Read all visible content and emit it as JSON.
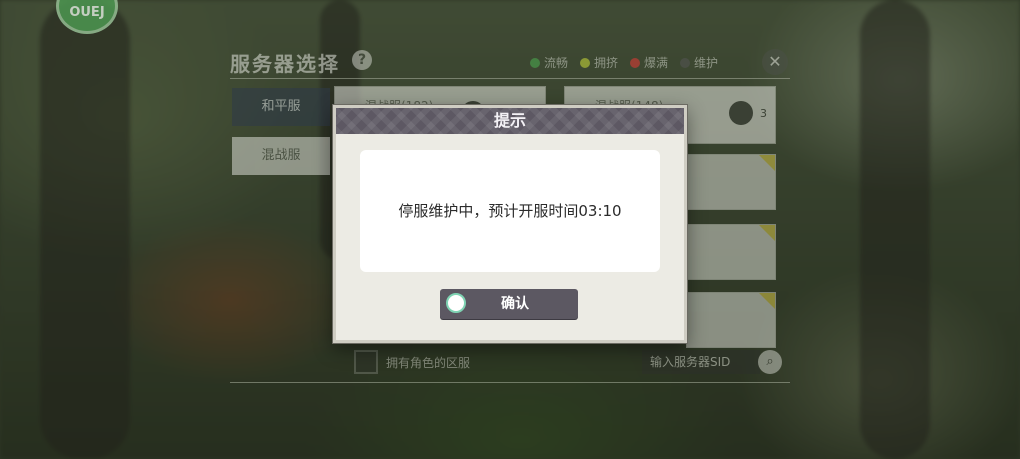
{
  "top_badge": {
    "text": "OUEJ"
  },
  "panel": {
    "title": "服务器选择",
    "help_icon": "?",
    "close_icon": "✕",
    "legend": [
      {
        "label": "流畅",
        "color": "#4caf50"
      },
      {
        "label": "拥挤",
        "color": "#cddc39"
      },
      {
        "label": "爆满",
        "color": "#e53935"
      },
      {
        "label": "维护",
        "color": "#555555"
      }
    ],
    "tabs": [
      {
        "label": "和平服",
        "active": true
      },
      {
        "label": "混战服",
        "active": false
      }
    ],
    "servers": [
      {
        "name": "混战服(182)"
      },
      {
        "name": "混战服(148)",
        "count": "3"
      }
    ],
    "partial_label": ")",
    "checkbox_label": "拥有角色的区服",
    "sid_placeholder": "输入服务器SID"
  },
  "dialog": {
    "title": "提示",
    "message": "停服维护中，预计开服时间03:10",
    "confirm_label": "确认"
  }
}
